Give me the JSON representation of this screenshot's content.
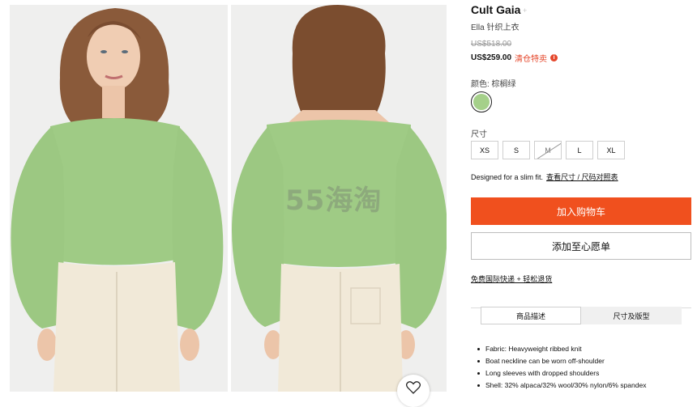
{
  "images": {
    "front": {
      "label": "model-front-view"
    },
    "back": {
      "label": "model-back-view"
    },
    "watermark": "55海淘",
    "wishlist_icon": "heart-outline-icon"
  },
  "product": {
    "brand": "Cult Gaia",
    "brand_icon": "+",
    "name": "Ella 针织上衣",
    "original_price": "US$518.00",
    "sale_price": "US$259.00",
    "sale_label": "清仓特卖",
    "info_icon": "i"
  },
  "color": {
    "label": "颜色: 棕榈绿",
    "swatch_hex": "#a5d08a"
  },
  "size": {
    "label": "尺寸",
    "options": [
      "XS",
      "S",
      "M",
      "L",
      "XL"
    ],
    "unavailable": "M"
  },
  "fit": {
    "text": "Designed for a slim fit.",
    "link": "查看尺寸 / 尺码对照表"
  },
  "actions": {
    "add_to_cart": "加入购物车",
    "add_to_wishlist": "添加至心愿单",
    "accent_color": "#f0501e"
  },
  "shipping": "免费国际快递 + 轻松退货",
  "tabs": [
    "商品描述",
    "尺寸及版型"
  ],
  "details": [
    "Fabric: Heavyweight ribbed knit",
    "Boat neckline can be worn off-shoulder",
    "Long sleeves with dropped shoulders",
    "Shell: 32% alpaca/32% wool/30% nylon/6% spandex"
  ]
}
